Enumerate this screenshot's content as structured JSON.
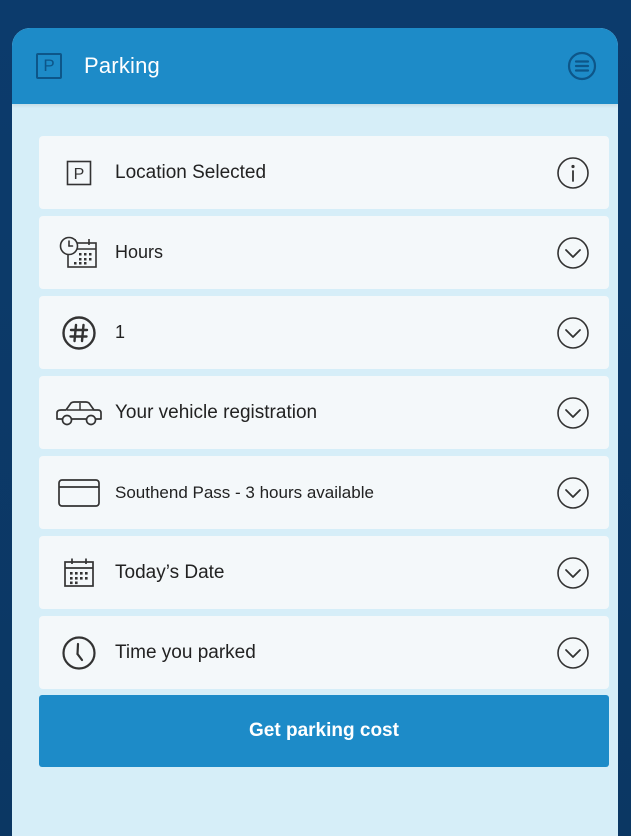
{
  "header": {
    "logo_glyph": "P",
    "title": "Parking",
    "menu_icon": "menu-circle-icon"
  },
  "rows": [
    {
      "label": "Location Selected",
      "icon": "parking-sign-icon",
      "icon_glyph": "P",
      "trail_icon": "info-icon"
    },
    {
      "label": "Hours",
      "icon": "clock-calendar-icon",
      "trail_icon": "chevron-down-circle-icon"
    },
    {
      "label": "1",
      "icon": "hash-circle-icon",
      "trail_icon": "chevron-down-circle-icon"
    },
    {
      "label": "Your vehicle registration",
      "icon": "car-icon",
      "trail_icon": "chevron-down-circle-icon"
    },
    {
      "label": "Southend Pass - 3 hours available",
      "icon": "card-icon",
      "trail_icon": "chevron-down-circle-icon"
    },
    {
      "label": "Today’s Date",
      "icon": "calendar-icon",
      "trail_icon": "chevron-down-circle-icon"
    },
    {
      "label": "Time you parked",
      "icon": "clock-icon",
      "trail_icon": "chevron-down-circle-icon"
    }
  ],
  "cta": {
    "label": "Get parking cost"
  },
  "colors": {
    "header": "#1d8bc8",
    "card_bg": "#d6eef8",
    "row_bg": "#f4f8fa",
    "outer_bg": "#0c3b6c",
    "button": "#1d8bc8"
  }
}
